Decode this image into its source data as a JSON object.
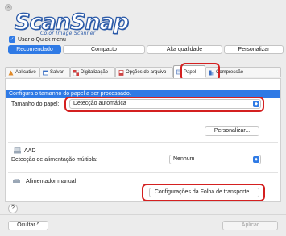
{
  "window": {
    "close_glyph": "×"
  },
  "logo": {
    "title": "ScanSnap",
    "subtitle": "Color Image Scanner"
  },
  "quick_menu": {
    "label": "Usar o Quick menu",
    "checked": true
  },
  "profiles": [
    {
      "label": "Recomendado",
      "selected": true
    },
    {
      "label": "Compacto",
      "selected": false
    },
    {
      "label": "Alta qualidade",
      "selected": false
    },
    {
      "label": "Personalizar",
      "selected": false
    }
  ],
  "tabs": [
    {
      "label": "Aplicativo",
      "icon": "application-icon"
    },
    {
      "label": "Salvar",
      "icon": "save-icon"
    },
    {
      "label": "Digitalização",
      "icon": "scanning-icon"
    },
    {
      "label": "Opções do arquivo",
      "icon": "file-options-icon"
    },
    {
      "label": "Papel",
      "icon": "paper-icon",
      "active": true
    },
    {
      "label": "Compressão",
      "icon": "compression-icon"
    }
  ],
  "panel": {
    "header": "Configura o tamanho do papel a ser processado.",
    "paper_size_label": "Tamanho do papel:",
    "paper_size_value": "Detecção automática",
    "customize_button": "Personalizar...",
    "adf_label": "AAD",
    "multifeed_label": "Detecção de alimentação múltipla:",
    "multifeed_value": "Nenhum",
    "manual_feeder_label": "Alimentador manual",
    "carrier_sheet_button": "Configurações da Folha de transporte..."
  },
  "footer": {
    "help_glyph": "?",
    "hide_button": "Ocultar",
    "hide_chevron": "^",
    "apply_button": "Aplicar"
  },
  "colors": {
    "accent": "#2f7ae5",
    "highlight": "#d42020",
    "logo": "#2b5aa8"
  }
}
